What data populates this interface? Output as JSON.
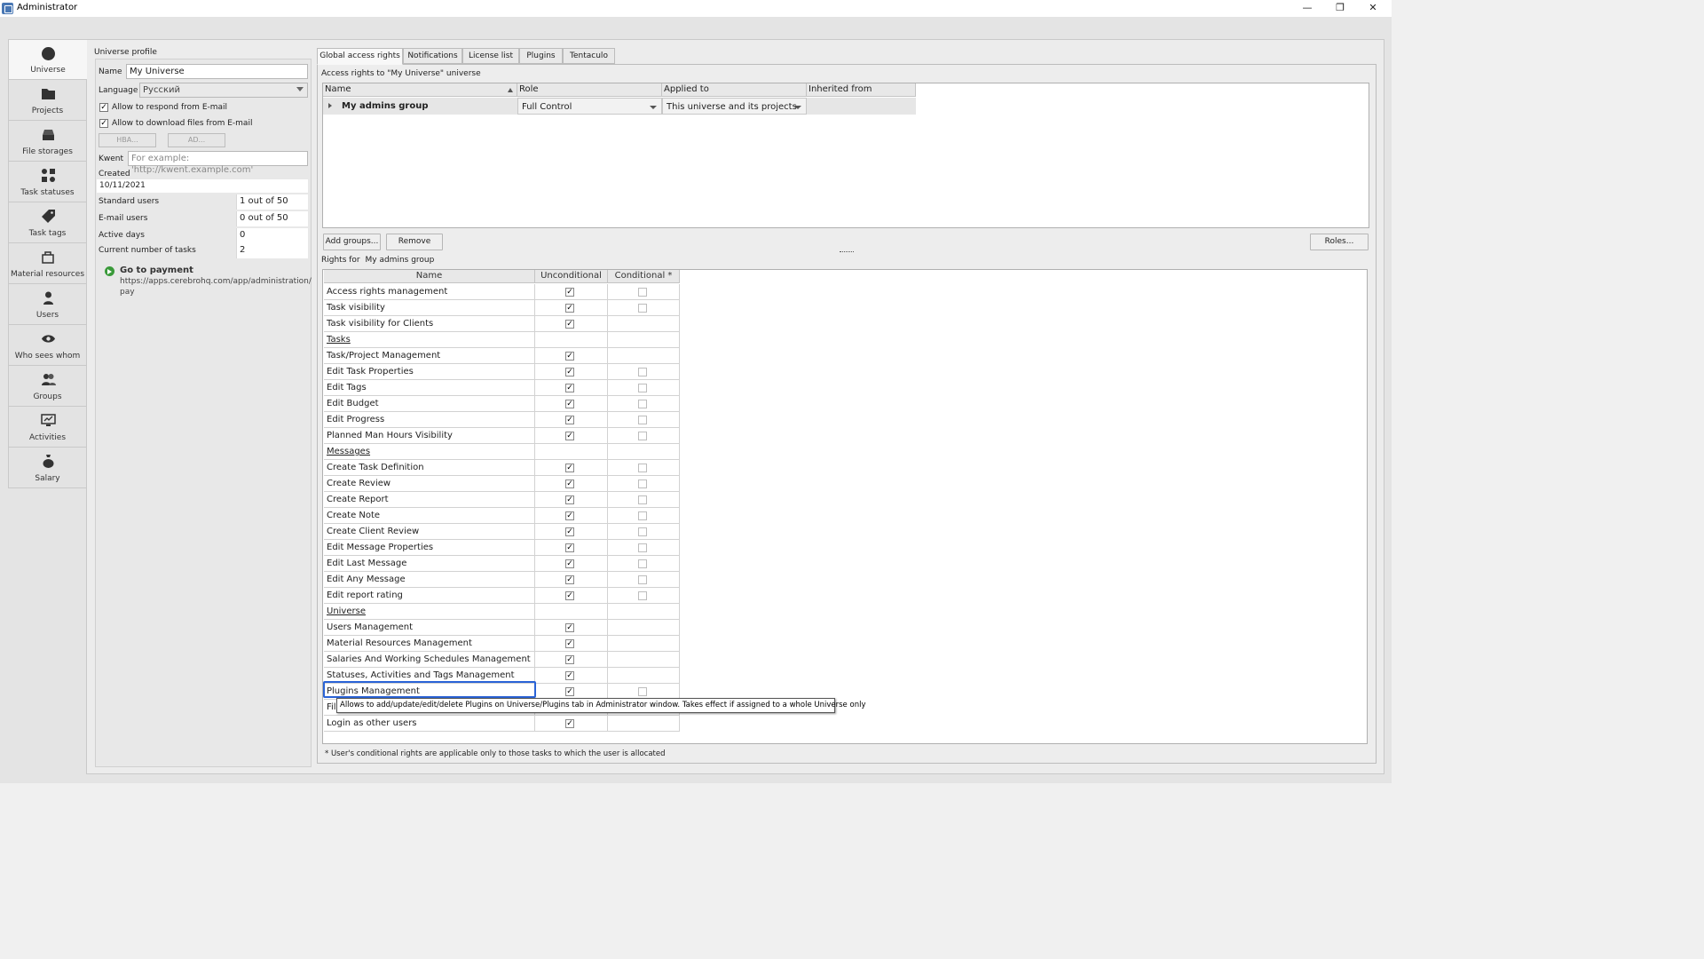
{
  "window": {
    "title": "Administrator",
    "controls": {
      "minimize": "—",
      "restore": "❐",
      "close": "✕"
    }
  },
  "nav": {
    "items": [
      {
        "label": "Universe",
        "icon": "universe-icon"
      },
      {
        "label": "Projects",
        "icon": "folder-icon"
      },
      {
        "label": "File storages",
        "icon": "storage-icon"
      },
      {
        "label": "Task statuses",
        "icon": "statuses-icon"
      },
      {
        "label": "Task tags",
        "icon": "tag-icon"
      },
      {
        "label": "Material resources",
        "icon": "resources-icon"
      },
      {
        "label": "Users",
        "icon": "user-icon"
      },
      {
        "label": "Who sees whom",
        "icon": "eye-icon"
      },
      {
        "label": "Groups",
        "icon": "groups-icon"
      },
      {
        "label": "Activities",
        "icon": "activities-icon"
      },
      {
        "label": "Salary",
        "icon": "moneybag-icon"
      }
    ]
  },
  "profile": {
    "section_title": "Universe profile",
    "name_label": "Name",
    "name_value": "My Universe",
    "language_label": "Language",
    "language_value": "Русский",
    "allow_respond_label": "Allow to respond from E-mail",
    "allow_download_label": "Allow to download files from E-mail",
    "hba_button": "HBA...",
    "ad_button": "AD...",
    "kwent_label": "Kwent",
    "kwent_placeholder": "For example: 'http://kwent.example.com'",
    "created_label": "Created",
    "created_value": "10/11/2021",
    "stats": [
      {
        "label": "Standard users",
        "value": "1 out of 50"
      },
      {
        "label": "E-mail users",
        "value": "0 out of 50"
      },
      {
        "label": "Active days",
        "value": "0"
      },
      {
        "label": "Current number of tasks",
        "value": "2"
      }
    ],
    "payment_title": "Go to payment",
    "payment_url_line1": "https://apps.cerebrohq.com/app/administration/",
    "payment_url_line2": "pay"
  },
  "tabs": [
    "Global access rights",
    "Notifications",
    "License list",
    "Plugins",
    "Tentaculo"
  ],
  "access": {
    "caption": "Access rights to \"My Universe\" universe",
    "columns": [
      "Name",
      "Role",
      "Applied to",
      "Inherited from"
    ],
    "row": {
      "name": "My admins group",
      "role": "Full Control",
      "applied_to": "This universe and its projects",
      "inherited_from": ""
    },
    "add_groups_button": "Add groups...",
    "remove_button": "Remove",
    "roles_button": "Roles..."
  },
  "rights": {
    "caption_prefix": "Rights for",
    "caption_group": "My admins group",
    "columns": [
      "Name",
      "Unconditional",
      "Conditional *"
    ],
    "rows": [
      {
        "name": "Access rights management",
        "u": true,
        "c": false,
        "hasC": true,
        "group": false
      },
      {
        "name": "Task visibility",
        "u": true,
        "c": false,
        "hasC": true,
        "group": false
      },
      {
        "name": "Task visibility for Clients",
        "u": true,
        "c": false,
        "hasC": false,
        "group": false
      },
      {
        "name": "Tasks",
        "u": null,
        "c": null,
        "hasC": false,
        "group": true
      },
      {
        "name": "Task/Project Management",
        "u": true,
        "c": false,
        "hasC": false,
        "group": false
      },
      {
        "name": "Edit Task Properties",
        "u": true,
        "c": false,
        "hasC": true,
        "group": false
      },
      {
        "name": "Edit Tags",
        "u": true,
        "c": false,
        "hasC": true,
        "group": false
      },
      {
        "name": "Edit Budget",
        "u": true,
        "c": false,
        "hasC": true,
        "group": false
      },
      {
        "name": "Edit Progress",
        "u": true,
        "c": false,
        "hasC": true,
        "group": false
      },
      {
        "name": "Planned Man Hours Visibility",
        "u": true,
        "c": false,
        "hasC": true,
        "group": false
      },
      {
        "name": "Messages",
        "u": null,
        "c": null,
        "hasC": false,
        "group": true
      },
      {
        "name": "Create Task Definition",
        "u": true,
        "c": false,
        "hasC": true,
        "group": false
      },
      {
        "name": "Create Review",
        "u": true,
        "c": false,
        "hasC": true,
        "group": false
      },
      {
        "name": "Create Report",
        "u": true,
        "c": false,
        "hasC": true,
        "group": false
      },
      {
        "name": "Create Note",
        "u": true,
        "c": false,
        "hasC": true,
        "group": false
      },
      {
        "name": "Create Client Review",
        "u": true,
        "c": false,
        "hasC": true,
        "group": false
      },
      {
        "name": "Edit Message Properties",
        "u": true,
        "c": false,
        "hasC": true,
        "group": false
      },
      {
        "name": "Edit Last Message",
        "u": true,
        "c": false,
        "hasC": true,
        "group": false
      },
      {
        "name": "Edit Any Message",
        "u": true,
        "c": false,
        "hasC": true,
        "group": false
      },
      {
        "name": "Edit report rating",
        "u": true,
        "c": false,
        "hasC": true,
        "group": false
      },
      {
        "name": "Universe",
        "u": null,
        "c": null,
        "hasC": false,
        "group": true
      },
      {
        "name": "Users Management",
        "u": true,
        "c": false,
        "hasC": false,
        "group": false
      },
      {
        "name": "Material Resources Management",
        "u": true,
        "c": false,
        "hasC": false,
        "group": false
      },
      {
        "name": "Salaries And Working Schedules Management",
        "u": true,
        "c": false,
        "hasC": false,
        "group": false
      },
      {
        "name": "Statuses, Activities and Tags Management",
        "u": true,
        "c": false,
        "hasC": false,
        "group": false
      },
      {
        "name": "Plugins Management",
        "u": true,
        "c": false,
        "hasC": true,
        "group": false
      },
      {
        "name": "Fil",
        "u": null,
        "c": null,
        "hasC": false,
        "group": false
      },
      {
        "name": "Login as other users",
        "u": true,
        "c": false,
        "hasC": false,
        "group": false
      }
    ],
    "tooltip": "Allows to add/update/edit/delete Plugins on Universe/Plugins tab in Administrator window. Takes effect if assigned to a whole Universe only",
    "footnote": "* User's conditional rights are applicable only to those tasks to which the user is allocated"
  },
  "colors": {
    "selection": "#2a63d6",
    "payment_icon": "#3a9a3a"
  }
}
